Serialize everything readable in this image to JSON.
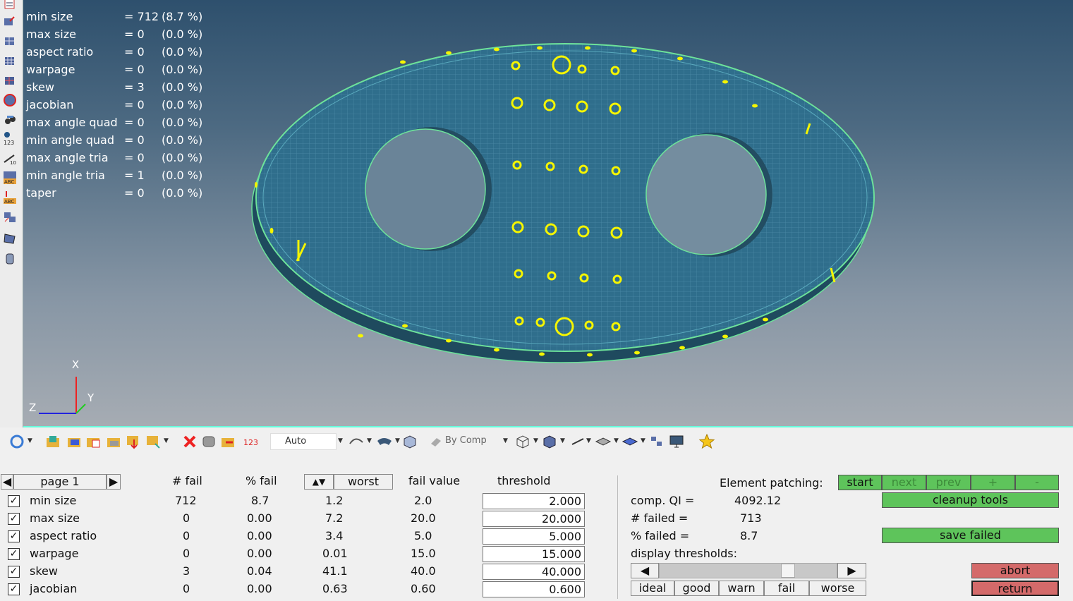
{
  "stats": [
    {
      "name": "min size",
      "eq": "= 712",
      "pct": "(8.7 %)"
    },
    {
      "name": "max size",
      "eq": "= 0",
      "pct": "(0.0 %)"
    },
    {
      "name": "aspect ratio",
      "eq": "= 0",
      "pct": "(0.0 %)"
    },
    {
      "name": "warpage",
      "eq": "= 0",
      "pct": "(0.0 %)"
    },
    {
      "name": "skew",
      "eq": "= 3",
      "pct": "(0.0 %)"
    },
    {
      "name": "jacobian",
      "eq": "= 0",
      "pct": "(0.0 %)"
    },
    {
      "name": "max angle quad",
      "eq": "= 0",
      "pct": "(0.0 %)"
    },
    {
      "name": "min angle quad",
      "eq": "= 0",
      "pct": "(0.0 %)"
    },
    {
      "name": "max angle tria",
      "eq": "= 0",
      "pct": "(0.0 %)"
    },
    {
      "name": "min angle tria",
      "eq": "= 1",
      "pct": "(0.0 %)"
    },
    {
      "name": "taper",
      "eq": "= 0",
      "pct": "(0.0 %)"
    }
  ],
  "axes": {
    "x": "X",
    "y": "Y",
    "z": "Z"
  },
  "toolbar": {
    "display_mode": "Auto",
    "color_mode": "By Comp"
  },
  "panel": {
    "page_label": "page 1",
    "headers": {
      "fail": "# fail",
      "pct_fail": "% fail",
      "worst": "worst",
      "fail_value": "fail value",
      "threshold": "threshold"
    },
    "rows": [
      {
        "name": "min size",
        "fail": "712",
        "pct": "8.7",
        "worst": "1.2",
        "fail_value": "2.0",
        "threshold": "2.000",
        "checked": "✓"
      },
      {
        "name": "max size",
        "fail": "0",
        "pct": "0.00",
        "worst": "7.2",
        "fail_value": "20.0",
        "threshold": "20.000",
        "checked": "✓"
      },
      {
        "name": "aspect ratio",
        "fail": "0",
        "pct": "0.00",
        "worst": "3.4",
        "fail_value": "5.0",
        "threshold": "5.000",
        "checked": "✓"
      },
      {
        "name": "warpage",
        "fail": "0",
        "pct": "0.00",
        "worst": "0.01",
        "fail_value": "15.0",
        "threshold": "15.000",
        "checked": "✓"
      },
      {
        "name": "skew",
        "fail": "3",
        "pct": "0.04",
        "worst": "41.1",
        "fail_value": "40.0",
        "threshold": "40.000",
        "checked": "✓"
      },
      {
        "name": "jacobian",
        "fail": "0",
        "pct": "0.00",
        "worst": "0.63",
        "fail_value": "0.60",
        "threshold": "0.600",
        "checked": "✓"
      }
    ],
    "patching_label": "Element patching:",
    "patch_buttons": {
      "start": "start",
      "next": "next",
      "prev": "prev",
      "plus": "+",
      "minus": "-"
    },
    "cleanup_tools": "cleanup tools",
    "save_failed": "save failed",
    "abort": "abort",
    "return": "return",
    "comp_qi_label": "comp. QI =",
    "comp_qi_value": "4092.12",
    "failed_label": "# failed =",
    "failed_value": "713",
    "pct_failed_label": "% failed =",
    "pct_failed_value": "8.7",
    "display_thresholds": "display thresholds:",
    "threshold_levels": {
      "ideal": "ideal",
      "good": "good",
      "warn": "warn",
      "fail": "fail",
      "worse": "worse"
    }
  }
}
